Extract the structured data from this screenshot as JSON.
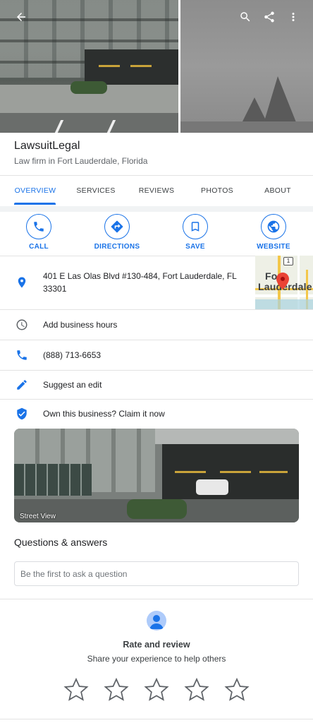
{
  "place": {
    "name": "LawsuitLegal",
    "category": "Law firm in Fort Lauderdale, Florida"
  },
  "tabs": [
    {
      "label": "OVERVIEW",
      "active": true
    },
    {
      "label": "SERVICES",
      "active": false
    },
    {
      "label": "REVIEWS",
      "active": false
    },
    {
      "label": "PHOTOS",
      "active": false
    },
    {
      "label": "ABOUT",
      "active": false
    }
  ],
  "actions": {
    "call": "CALL",
    "directions": "DIRECTIONS",
    "save": "SAVE",
    "website": "WEBSITE"
  },
  "info": {
    "address_line1": "401 E Las Olas Blvd #130-484, Fort Lauderdale, FL",
    "address_line2": "33301",
    "hours": "Add business hours",
    "phone": "(888) 713-6653",
    "suggest_edit": "Suggest an edit",
    "claim": "Own this business? Claim it now"
  },
  "map": {
    "city_line1": "Fort",
    "city_line2": "Lauderdale",
    "route_shield": "1"
  },
  "street_view": {
    "label": "Street View"
  },
  "qa": {
    "title": "Questions & answers",
    "placeholder": "Be the first to ask a question"
  },
  "rate": {
    "title": "Rate and review",
    "subtitle": "Share your experience to help others",
    "stars_total": 5,
    "stars_selected": 0
  },
  "icons": {
    "back": "arrow-left-icon",
    "search": "search-icon",
    "share": "share-icon",
    "more": "more-vert-icon",
    "location": "location-pin-icon",
    "clock": "clock-icon",
    "phone": "phone-icon",
    "edit": "pencil-icon",
    "verified": "verified-shield-icon"
  },
  "colors": {
    "accent": "#1a73e8",
    "text_primary": "#202124",
    "text_secondary": "#5f6368",
    "map_pin": "#ea4335"
  }
}
